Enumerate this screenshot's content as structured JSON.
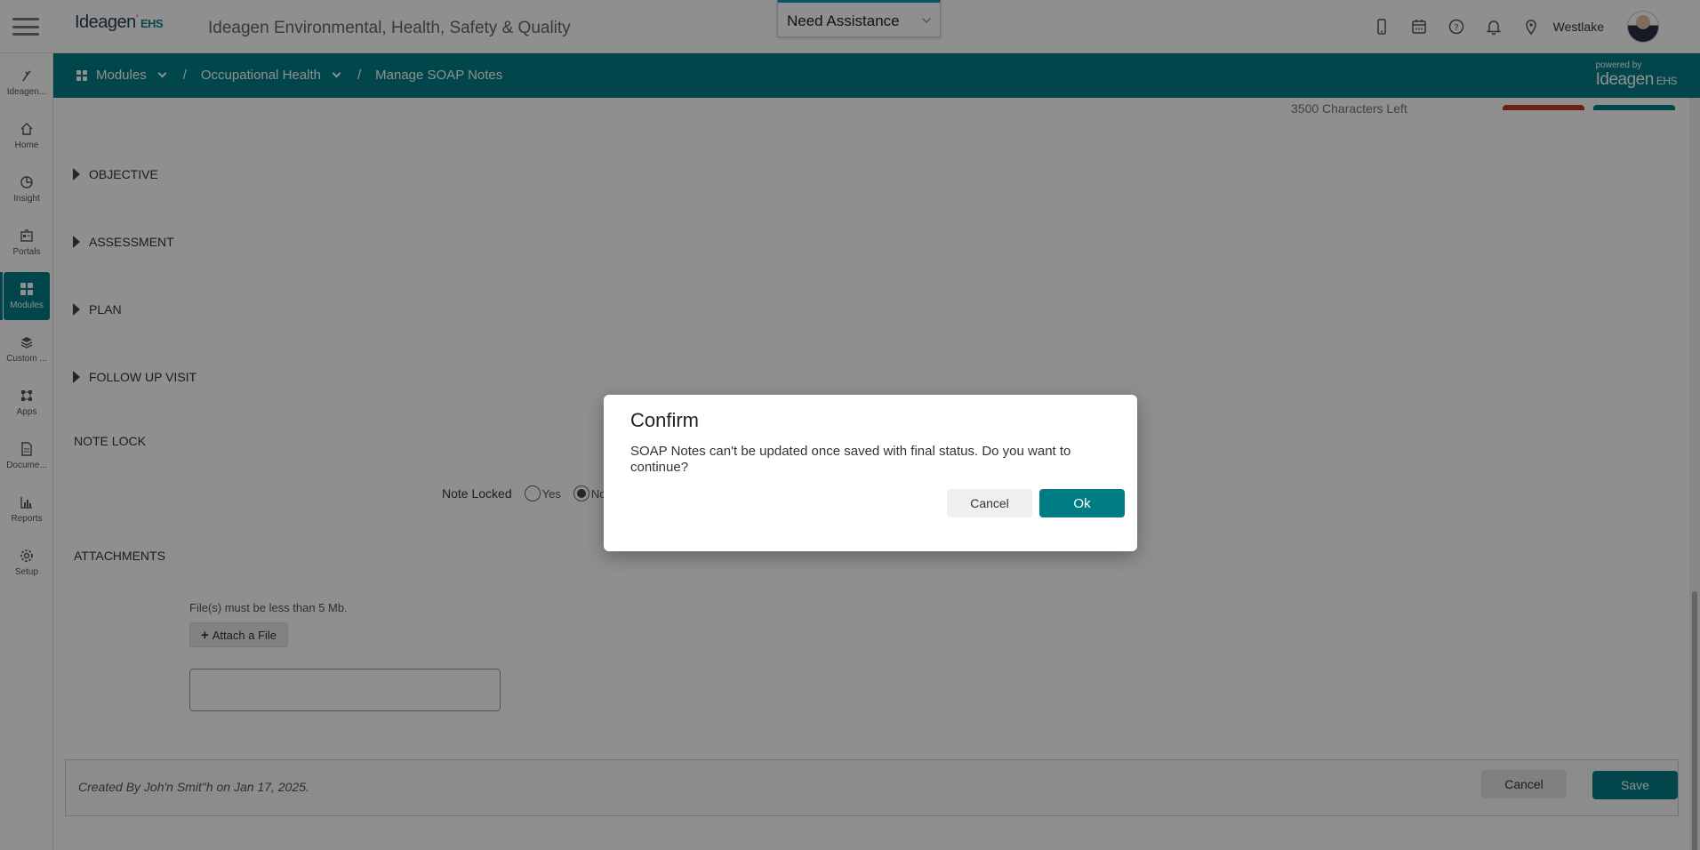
{
  "header": {
    "logo_text": "Ideagen",
    "logo_suffix": "EHS",
    "app_title": "Ideagen Environmental, Health, Safety & Quality",
    "assist_label": "Need Assistance",
    "location": "Westlake"
  },
  "breadcrumb": {
    "modules": "Modules",
    "sep1": "/",
    "occupational_health": "Occupational Health",
    "sep2": "/",
    "current": "Manage SOAP Notes"
  },
  "powered": {
    "line1": "powered by",
    "brand": "Ideagen",
    "suffix": "EHS"
  },
  "sidebar": {
    "items": [
      {
        "label": "Ideagen..."
      },
      {
        "label": "Home"
      },
      {
        "label": "Insight"
      },
      {
        "label": "Portals"
      },
      {
        "label": "Modules"
      },
      {
        "label": "Custom ..."
      },
      {
        "label": "Apps"
      },
      {
        "label": "Docume..."
      },
      {
        "label": "Reports"
      },
      {
        "label": "Setup"
      }
    ]
  },
  "main": {
    "chars_left": "3500 Characters Left",
    "sections": {
      "objective": "OBJECTIVE",
      "assessment": "ASSESSMENT",
      "plan": "PLAN",
      "follow_up": "FOLLOW UP VISIT"
    },
    "note_lock": {
      "heading": "NOTE LOCK",
      "label": "Note Locked",
      "yes": "Yes",
      "no": "No"
    },
    "attachments": {
      "heading": "ATTACHMENTS",
      "note": "File(s) must be less than 5 Mb.",
      "button": "Attach a File"
    },
    "footer": {
      "created": "Created By Joh'n Smit\"h on Jan 17, 2025.",
      "cancel": "Cancel",
      "save": "Save"
    }
  },
  "modal": {
    "title": "Confirm",
    "message": "SOAP Notes can't be updated once saved with final status. Do you want to continue?",
    "cancel": "Cancel",
    "ok": "Ok"
  },
  "colors": {
    "brand_teal": "#007d84",
    "assist_accent": "#0a99b8",
    "overlay": "rgba(0,0,0,0.44)"
  }
}
